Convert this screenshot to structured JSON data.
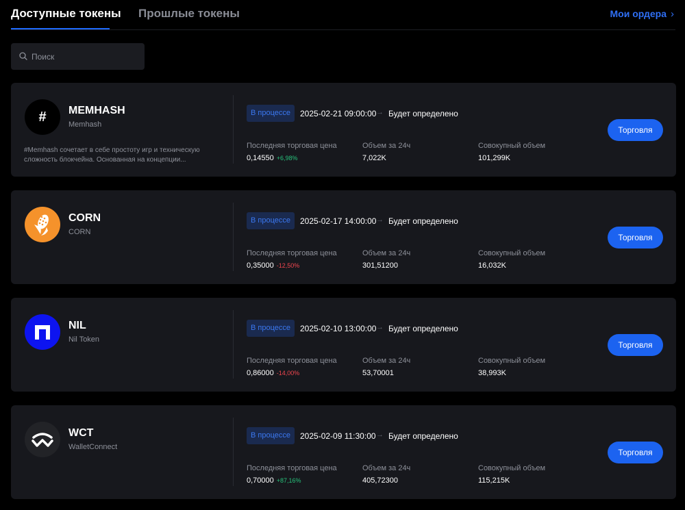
{
  "tabs": {
    "available": "Доступные токены",
    "past": "Прошлые токены",
    "orders_link": "Мои ордера"
  },
  "search": {
    "placeholder": "Поиск"
  },
  "labels": {
    "last_price": "Последняя торговая цена",
    "volume_24h": "Объем за 24ч",
    "total_volume": "Совокупный объем",
    "trade_button": "Торговля"
  },
  "colors": {
    "accent": "#1c63f0",
    "positive": "#27c27b",
    "negative": "#f0464f",
    "card_bg": "#17181d"
  },
  "tokens": [
    {
      "symbol": "MEMHASH",
      "name": "Memhash",
      "icon": "hash-icon",
      "description": "#Memhash сочетает в себе простоту игр и техническую сложность блокчейна. Основанная на концепции...",
      "status": "В процессе",
      "start": "2025-02-21 09:00:00",
      "end": "Будет определено",
      "price": "0,14550",
      "change": "+6,98%",
      "volume_24h": "7,022K",
      "total_volume": "101,299K"
    },
    {
      "symbol": "CORN",
      "name": "CORN",
      "icon": "corn-icon",
      "description": "",
      "status": "В процессе",
      "start": "2025-02-17 14:00:00",
      "end": "Будет определено",
      "price": "0,35000",
      "change": "-12,50%",
      "volume_24h": "301,51200",
      "total_volume": "16,032K"
    },
    {
      "symbol": "NIL",
      "name": "Nil Token",
      "icon": "nil-icon",
      "description": "",
      "status": "В процессе",
      "start": "2025-02-10 13:00:00",
      "end": "Будет определено",
      "price": "0,86000",
      "change": "-14,00%",
      "volume_24h": "53,70001",
      "total_volume": "38,993K"
    },
    {
      "symbol": "WCT",
      "name": "WalletConnect",
      "icon": "walletconnect-icon",
      "description": "",
      "status": "В процессе",
      "start": "2025-02-09 11:30:00",
      "end": "Будет определено",
      "price": "0,70000",
      "change": "+87,16%",
      "volume_24h": "405,72300",
      "total_volume": "115,215K"
    }
  ]
}
